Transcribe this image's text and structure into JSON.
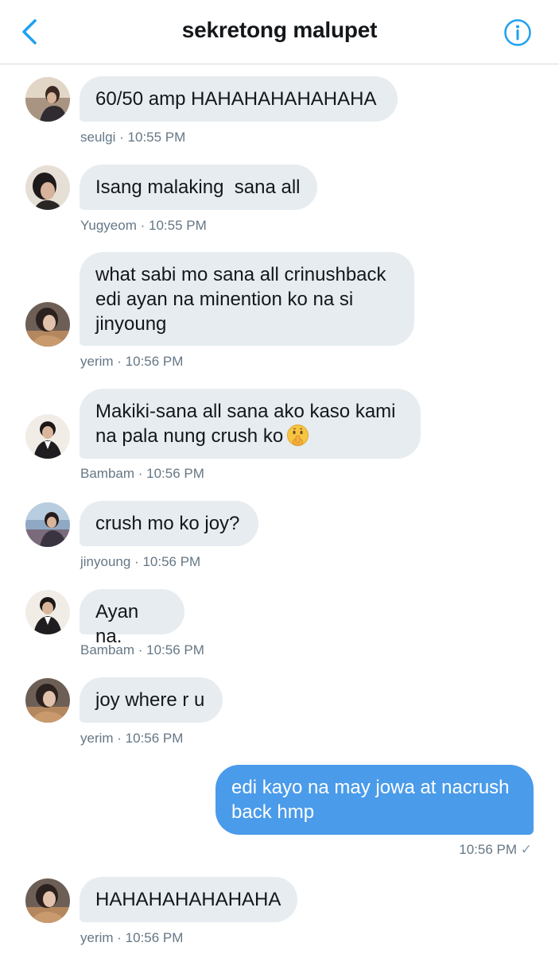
{
  "header": {
    "title": "sekretong malupet",
    "back_icon": "chevron-left-icon",
    "info_icon": "info-circle-icon"
  },
  "colors": {
    "accent": "#1da1f2",
    "own_bubble": "#4a9bea",
    "other_bubble": "#e6ecf0",
    "meta_text": "#657786"
  },
  "messages": [
    {
      "sender": "seulgi",
      "time": "10:55 PM",
      "lines": [
        "60/50 amp HAHAHAHAHAHAHA"
      ]
    },
    {
      "sender": "Yugyeom",
      "time": "10:55 PM",
      "lines": [
        "Isang malaking  sana all"
      ]
    },
    {
      "sender": "yerim",
      "time": "10:56 PM",
      "lines": [
        "what sabi mo sana all crinushback",
        "edi ayan na minention ko na si",
        "jinyoung"
      ]
    },
    {
      "sender": "Bambam",
      "time": "10:56 PM",
      "lines": [
        "Makiki-sana all sana ako kaso kami",
        "na pala nung crush ko"
      ],
      "emoji": "shushing-face-emoji"
    },
    {
      "sender": "jinyoung",
      "time": "10:56 PM",
      "lines": [
        "crush mo ko joy?"
      ]
    },
    {
      "sender": "Bambam",
      "time": "10:56 PM",
      "lines": [
        "Ayan na."
      ]
    },
    {
      "sender": "yerim",
      "time": "10:56 PM",
      "lines": [
        "joy where r u"
      ]
    },
    {
      "sender": "me",
      "time": "10:56 PM",
      "lines": [
        "edi kayo na may jowa at nacrush",
        "back hmp"
      ],
      "status": "✓"
    },
    {
      "sender": "yerim",
      "time": "10:56 PM",
      "lines": [
        "HAHAHAHAHAHAHA"
      ]
    }
  ],
  "separator": " · "
}
